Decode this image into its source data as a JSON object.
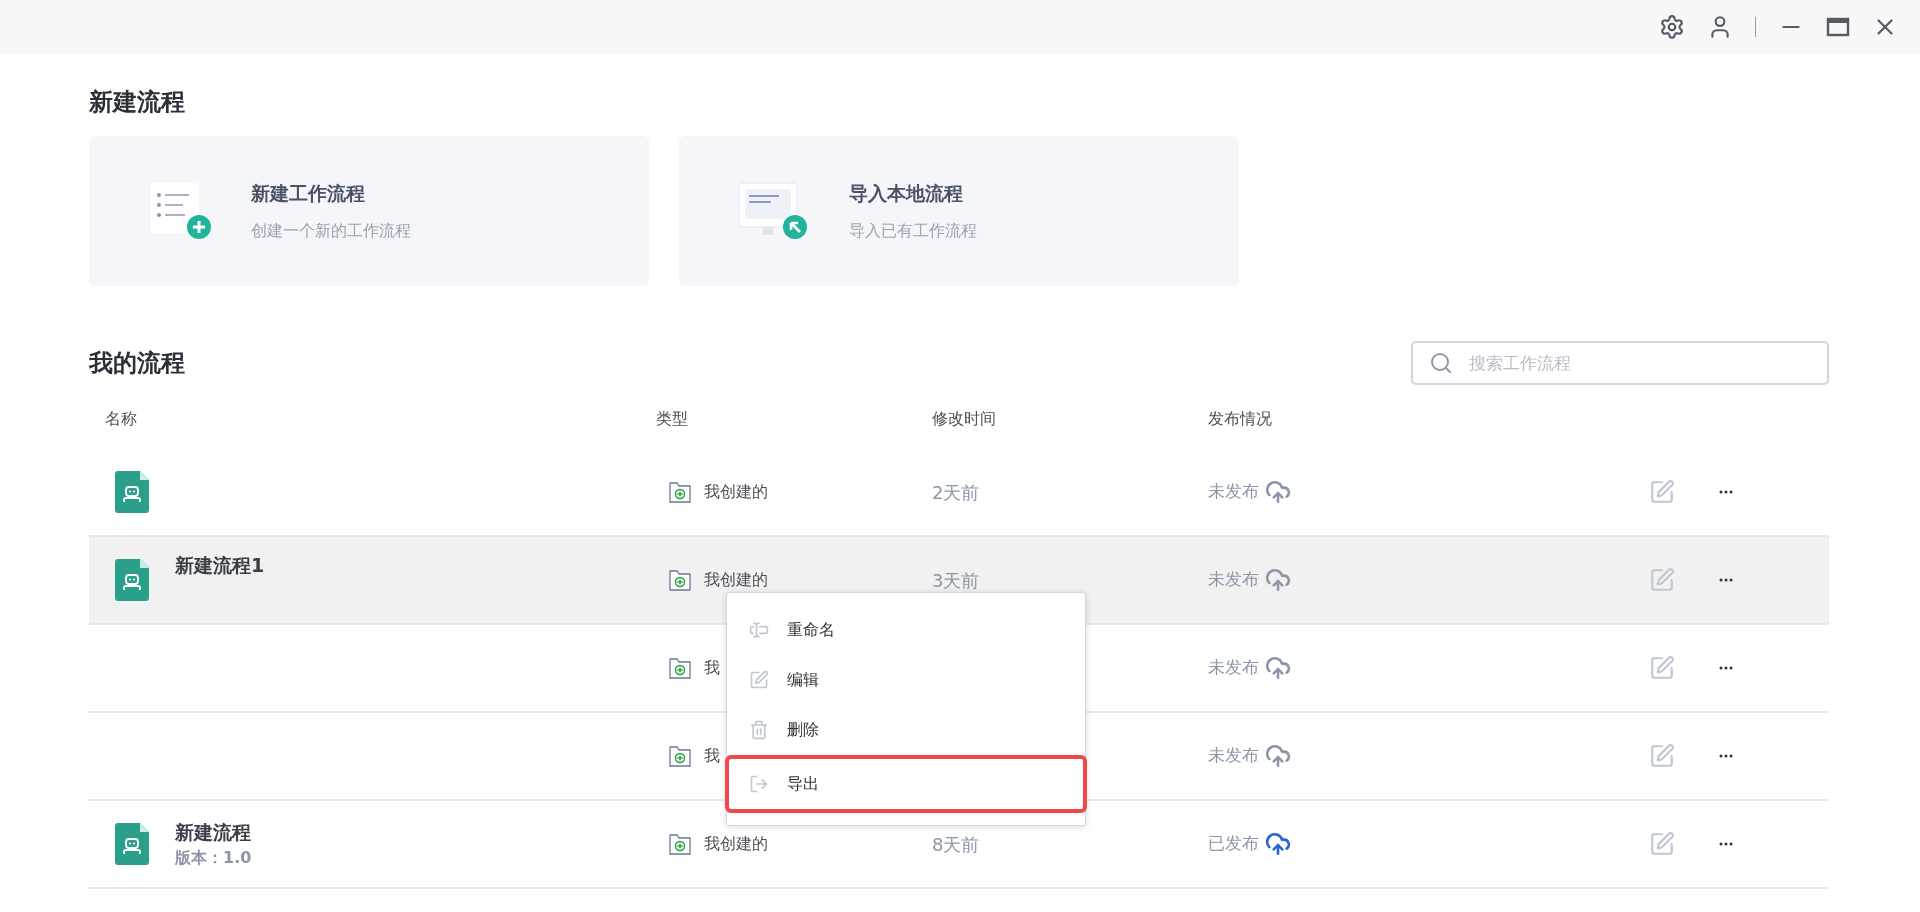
{
  "new_section": {
    "title": "新建流程",
    "cards": [
      {
        "kind": "create",
        "title": "新建工作流程",
        "subtitle": "创建一个新的工作流程"
      },
      {
        "kind": "import",
        "title": "导入本地流程",
        "subtitle": "导入已有工作流程"
      }
    ]
  },
  "my_section": {
    "title": "我的流程",
    "search": {
      "placeholder": "搜索工作流程"
    }
  },
  "table": {
    "columns": [
      "名称",
      "类型",
      "修改时间",
      "发布情况"
    ],
    "rows": [
      {
        "has_icon": true,
        "name": "",
        "version": "",
        "type": "我创建的",
        "modified": "2天前",
        "status": "未发布",
        "published": false,
        "highlighted": false
      },
      {
        "has_icon": true,
        "name": "新建流程1",
        "version": "",
        "type": "我创建的",
        "modified": "3天前",
        "status": "未发布",
        "published": false,
        "highlighted": true
      },
      {
        "has_icon": false,
        "name": "",
        "version": "",
        "type": "我",
        "modified": "",
        "status": "未发布",
        "published": false,
        "highlighted": false
      },
      {
        "has_icon": false,
        "name": "",
        "version": "",
        "type": "我",
        "modified": "",
        "status": "未发布",
        "published": false,
        "highlighted": false
      },
      {
        "has_icon": true,
        "name": "新建流程",
        "version": "版本：1.0",
        "type": "我创建的",
        "modified": "8天前",
        "status": "已发布",
        "published": true,
        "highlighted": false
      }
    ]
  },
  "context_menu": {
    "items": [
      {
        "kind": "rename",
        "label": "重命名",
        "outlined": false
      },
      {
        "kind": "edit",
        "label": "编辑",
        "outlined": false
      },
      {
        "kind": "delete",
        "label": "删除",
        "outlined": false
      },
      {
        "kind": "export",
        "label": "导出",
        "outlined": true
      }
    ]
  }
}
